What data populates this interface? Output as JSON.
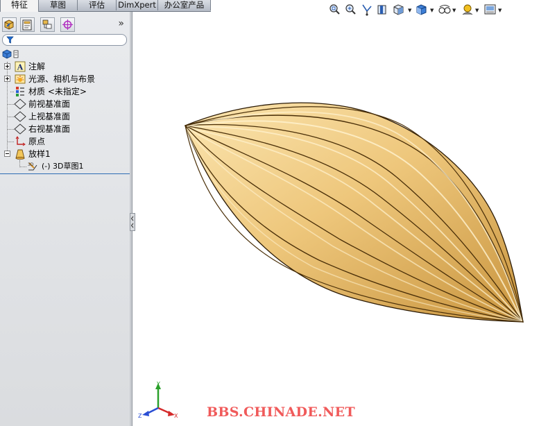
{
  "tabs": [
    {
      "label": "特征",
      "active": true
    },
    {
      "label": "草图",
      "active": false
    },
    {
      "label": "评估",
      "active": false
    },
    {
      "label": "DimXpert",
      "active": false
    },
    {
      "label": "办公室产品",
      "active": false
    }
  ],
  "panel": {
    "toolbar_icons": [
      "feature-manager-icon",
      "property-manager-icon",
      "configuration-manager-icon",
      "dim-xpert-manager-icon"
    ],
    "more_label": "»",
    "filter_icon": "filter-icon"
  },
  "tree": {
    "root_icon": "part-icon",
    "items": [
      {
        "label": "注解",
        "icon": "annotations-icon",
        "expander": "plus"
      },
      {
        "label": "光源、相机与布景",
        "icon": "lights-cameras-icon",
        "expander": "plus"
      },
      {
        "label": "材质 <未指定>",
        "icon": "material-icon",
        "expander": "none"
      },
      {
        "label": "前视基准面",
        "icon": "plane-icon",
        "expander": "none"
      },
      {
        "label": "上视基准面",
        "icon": "plane-icon",
        "expander": "none"
      },
      {
        "label": "右视基准面",
        "icon": "plane-icon",
        "expander": "none"
      },
      {
        "label": "原点",
        "icon": "origin-icon",
        "expander": "none"
      },
      {
        "label": "放样1",
        "icon": "loft-icon",
        "expander": "minus"
      },
      {
        "label": "(-) 3D草图1",
        "icon": "3d-sketch-icon",
        "expander": "none",
        "child": true
      }
    ]
  },
  "view_toolbar": [
    "zoom-to-fit-icon",
    "zoom-to-area-icon",
    "previous-view-icon",
    "section-view-icon",
    "view-orientation-icon",
    "display-style-icon",
    "hide-show-items-icon",
    "edit-appearance-icon",
    "apply-scene-icon"
  ],
  "triad": {
    "x": "X",
    "y": "Y",
    "z": "Z"
  },
  "watermark": "BBS.CHINADE.NET",
  "colors": {
    "shape_light": "#fbe7b6",
    "shape_mid": "#e8bd6a",
    "shape_dark": "#7a4f12",
    "panel_bg": "#e1e3e6",
    "tree_end_line": "#2c6bb4",
    "watermark": "#f05a5a"
  }
}
